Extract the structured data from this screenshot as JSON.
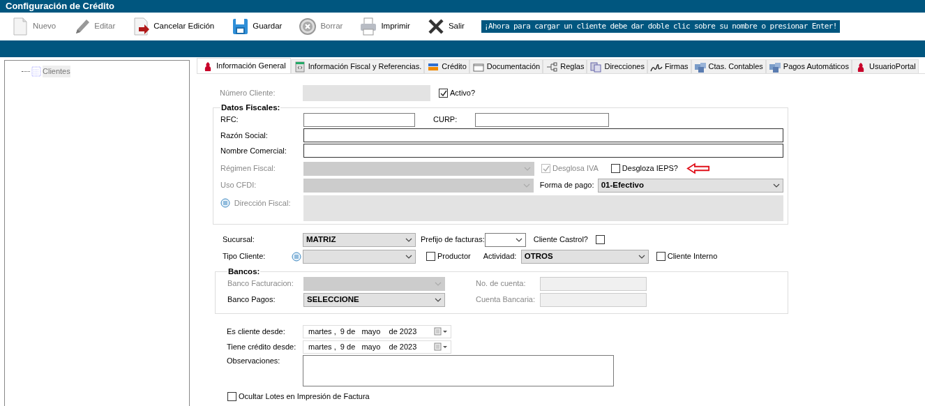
{
  "window": {
    "title": "Configuración de Crédito"
  },
  "toolbar": [
    {
      "kind": "new",
      "label": "Nuevo",
      "disabled": true
    },
    {
      "kind": "edit",
      "label": "Editar",
      "disabled": true
    },
    {
      "kind": "cancel",
      "label": "Cancelar Edición",
      "disabled": false
    },
    {
      "kind": "save",
      "label": "Guardar",
      "disabled": false
    },
    {
      "kind": "delete",
      "label": "Borrar",
      "disabled": true
    },
    {
      "kind": "print",
      "label": "Imprimir",
      "disabled": false
    },
    {
      "kind": "exit",
      "label": "Salir",
      "disabled": false
    }
  ],
  "notice": "¡Ahora para cargar un cliente debe dar doble clic sobre su nombre o presionar Enter!",
  "tree": [
    {
      "label": "Clientes",
      "selected": true
    }
  ],
  "tabs": [
    {
      "kind": "person",
      "label": "Información General",
      "selected": true
    },
    {
      "kind": "code",
      "label": "Información Fiscal y Referencias.",
      "selected": false
    },
    {
      "kind": "card",
      "label": "Crédito",
      "selected": false
    },
    {
      "kind": "folder",
      "label": "Documentación",
      "selected": false
    },
    {
      "kind": "rules",
      "label": "Reglas",
      "selected": false
    },
    {
      "kind": "address",
      "label": "Direcciones",
      "selected": false
    },
    {
      "kind": "signature",
      "label": "Firmas",
      "selected": false
    },
    {
      "kind": "cubes",
      "label": "Ctas. Contables",
      "selected": false
    },
    {
      "kind": "cubes",
      "label": "Pagos Automáticos",
      "selected": false
    },
    {
      "kind": "person",
      "label": "UsuarioPortal",
      "selected": false
    }
  ],
  "general": {
    "numero_cliente": {
      "label": "Número Cliente:",
      "disabled": true
    },
    "activo": {
      "label": "Activo?",
      "checked": true,
      "disabled": false
    },
    "datos_fiscales": {
      "legend": "Datos Fiscales:",
      "rfc": {
        "label": "RFC:",
        "disabled": false
      },
      "curp": {
        "label": "CURP:",
        "disabled": false
      },
      "razon_social": {
        "label": "Razón Social:",
        "disabled": false
      },
      "nombre_comercial": {
        "label": "Nombre Comercial:",
        "disabled": false
      },
      "regimen_fiscal": {
        "label": "Régimen Fiscal:",
        "disabled": true
      },
      "desglosa_iva": {
        "label": "Desglosa IVA",
        "checked": true,
        "disabled": true
      },
      "desgloza_ieps": {
        "label": "Desgloza IEPS?",
        "checked": false,
        "disabled": false
      },
      "uso_cfdi": {
        "label": "Uso CFDI:",
        "disabled": true
      },
      "forma_de_pago": {
        "label": "Forma de pago:",
        "value": "01-Efectivo",
        "disabled": false
      },
      "direccion_fiscal": {
        "label": "Dirección Fiscal:",
        "disabled": true
      }
    },
    "sucursal": {
      "label": "Sucursal:",
      "value": "MATRIZ",
      "disabled": false
    },
    "prefijo_facturas": {
      "label": "Prefijo de facturas:",
      "disabled": false
    },
    "cliente_castrol": {
      "label": "Cliente Castrol?",
      "checked": false,
      "disabled": false
    },
    "tipo_cliente": {
      "label": "Tipo Cliente:",
      "disabled": false
    },
    "productor": {
      "label": "Productor",
      "checked": false,
      "disabled": false
    },
    "actividad": {
      "label": "Actividad:",
      "value": "OTROS",
      "disabled": false
    },
    "cliente_interno": {
      "label": "Cliente Interno",
      "checked": false,
      "disabled": false
    },
    "bancos": {
      "legend": "Bancos:",
      "banco_facturacion": {
        "label": "Banco Facturacion:",
        "disabled": true
      },
      "banco_pagos": {
        "label": "Banco Pagos:",
        "value": "SELECCIONE",
        "disabled": false
      },
      "no_cuenta": {
        "label": "No. de cuenta:",
        "disabled": true
      },
      "cuenta_bancaria": {
        "label": "Cuenta Bancaria:",
        "disabled": true
      }
    },
    "es_cliente_desde": {
      "label": "Es cliente desde:",
      "value": "martes ,  9 de   mayo    de 2023"
    },
    "tiene_credito_desde": {
      "label": "Tiene crédito desde:",
      "value": "martes ,  9 de   mayo    de 2023"
    },
    "observaciones": {
      "label": "Observaciones:",
      "disabled": false
    },
    "ocultar_lotes": {
      "label": "Ocultar Lotes en Impresión de Factura",
      "checked": false,
      "disabled": false
    }
  }
}
